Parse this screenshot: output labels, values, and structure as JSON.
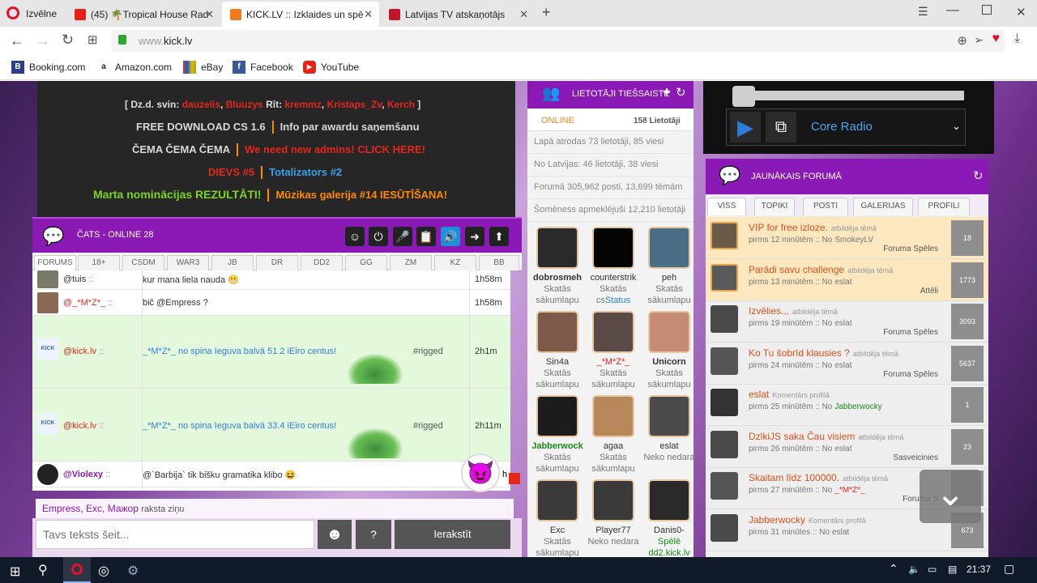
{
  "browser": {
    "menu_label": "Izvēlne",
    "tabs": [
      {
        "label": "(45) 🌴Tropical House Rad",
        "color": "#e62117"
      },
      {
        "label": "KICK.LV :: Izklaides un spē",
        "color": "#f07b1f"
      },
      {
        "label": "Latvijas TV atskaņotājs",
        "color": "#c4162a"
      }
    ],
    "new_tab_icon": "plus-icon",
    "url_prefix": "www.",
    "url_domain": "kick.lv",
    "bookmarks": [
      {
        "label": "Booking.com",
        "icon": "booking-icon",
        "color": "#2d3e8f",
        "glyph": "B"
      },
      {
        "label": "Amazon.com",
        "icon": "amazon-icon",
        "color": "#222222",
        "glyph": "a"
      },
      {
        "label": "eBay",
        "icon": "ebay-icon",
        "color": "#0064d2",
        "glyph": "e"
      },
      {
        "label": "Facebook",
        "icon": "facebook-icon",
        "color": "#3b5998",
        "glyph": "f"
      },
      {
        "label": "YouTube",
        "icon": "youtube-icon",
        "color": "#e62117",
        "glyph": "▶"
      }
    ]
  },
  "banner": {
    "dzd_prefix": "[ Dz.d. svin:",
    "birthdays": [
      "dauzelis",
      "Bluuzys"
    ],
    "rit_prefix": "Rīt:",
    "tomorrow": [
      "kremmz",
      "Kristaps_Zv",
      "Kerch"
    ],
    "close": "]",
    "line2": [
      "FREE DOWNLOAD CS 1.6",
      "Info par awardu saņemšanu"
    ],
    "line3": [
      "ČEMA ČEMA ČEMA",
      "We need new admins! CLICK HERE!"
    ],
    "line4": [
      "DIEVS #5",
      "Totalizators #2"
    ],
    "line5": [
      "Marta nominācijas REZULTĀTI!",
      "Mūzikas galerija #14 IESŪTĪŠANA!"
    ]
  },
  "chat": {
    "title": "ČATS - ONLINE 28",
    "tabs": [
      "FORUMS",
      "18+",
      "CSDM",
      "WAR3",
      "JB",
      "DR",
      "DD2",
      "GG",
      "ZM",
      "KZ",
      "BB"
    ],
    "rows": [
      {
        "name": "@tuis",
        "suffix": "::",
        "message": "kur mana liela nauda",
        "time": "1h58m"
      },
      {
        "name": "@_*M*Z*_",
        "suffix": "::",
        "message": "bič @Empress ?",
        "time": "1h58m"
      },
      {
        "name": "@kick.lv",
        "suffix": "::",
        "message": "_*M*Z*_ no spina Ieguva balvā 51.2 iEiro centus!",
        "tag": "#rigged",
        "time": "2h1m"
      },
      {
        "name": "@kick.lv",
        "suffix": "::",
        "message": "_*M*Z*_ no spina Ieguva balvā 33.4 iEiro centus!",
        "tag": "#rigged",
        "time": "2h11m"
      },
      {
        "name": "@Violexy",
        "suffix": "::",
        "message": "@`Barbija` tik bišku gramatika klibo",
        "time": "h"
      }
    ],
    "typing_users": [
      "Empress",
      "Exc",
      "Мажор"
    ],
    "typing_suffix": "raksta ziņu",
    "input_placeholder": "Tavs teksts šeit...",
    "help_label": "?",
    "send_label": "Ierakstīt"
  },
  "online": {
    "title": "LIETOTĀJI TIEŠSAISTĒ",
    "tab_label": "ONLINE",
    "count": "158 Lietotāji",
    "stats": [
      "Lapā atrodas 73 lietotāji, 85 viesi",
      "No Latvijas: 46 lietotāji, 38 viesi",
      "Forumā 305,962 posti, 13,699 tēmām",
      "Šomēness apmeklējuši 12,210 lietotāji"
    ],
    "users": [
      {
        "name": "dobrosmeh",
        "bold": true,
        "l1": "Skatās",
        "l2": "sākumlapu",
        "color": "#2a2a2a"
      },
      {
        "name": "counterstrik",
        "bold": false,
        "l1": "Skatās",
        "l2": "cs",
        "l2b": "Status",
        "color": "#050505"
      },
      {
        "name": "peh",
        "bold": false,
        "l1": "Skatās",
        "l2": "sākumlapu",
        "color": "#4b6d86"
      },
      {
        "name": "Sin4a",
        "bold": false,
        "l1": "Skatās",
        "l2": "sākumlapu",
        "color": "#7b5a4a"
      },
      {
        "name": "_*M*Z*_",
        "bold": false,
        "red": true,
        "l1": "Skatās",
        "l2": "sākumlapu",
        "color": "#5a4a45"
      },
      {
        "name": "Unicorn",
        "bold": true,
        "l1": "Skatās",
        "l2": "sākumlapu",
        "color": "#c58b74"
      },
      {
        "name": "Jabberwock",
        "bold": true,
        "green": true,
        "l1": "Skatās",
        "l2": "sākumlapu",
        "color": "#1c1c1c"
      },
      {
        "name": "agaa",
        "bold": false,
        "l1": "Skatās",
        "l2": "sākumlapu",
        "color": "#b8885a"
      },
      {
        "name": "eslat",
        "bold": false,
        "l1": "Neko nedara",
        "l2": "",
        "color": "#4a4a4a"
      },
      {
        "name": "Exc",
        "bold": false,
        "l1": "Skatās",
        "l2": "sākumlapu",
        "color": "#3a3a3a"
      },
      {
        "name": "Player77",
        "bold": false,
        "l1": "Neko nedara",
        "l2": "",
        "color": "#3a3a3a"
      },
      {
        "name": "Danis0-",
        "bold": false,
        "l1": "Spēlē",
        "l2": "dd2.kick.lv",
        "green2": true,
        "color": "#2a2a2a"
      }
    ]
  },
  "radio": {
    "station": "Core Radio",
    "progress": 0.0
  },
  "forum": {
    "title": "JAUNĀKAIS FORUMĀ",
    "tabs": [
      "VISS",
      "TOPIKI",
      "POSTI",
      "GALERIJAS",
      "PROFILI"
    ],
    "items": [
      {
        "title": "VIP for free izloze.",
        "action": "atbildēja tēmā",
        "when": "pirms 12 minūtēm :: No",
        "who": "SmokeyLV",
        "cat": "Foruma Spēles",
        "count": "18",
        "hl": true,
        "who_red": false
      },
      {
        "title": "Parādi savu challenge",
        "action": "atbildēja tēmā",
        "when": "pirms 13 minūtēm :: No",
        "who": "eslat",
        "cat": "Attēli",
        "count": "1773",
        "hl": true,
        "who_red": false
      },
      {
        "title": "Izvēlies...",
        "action": "atbildēja tēmā",
        "when": "pirms 19 minūtēm :: No",
        "who": "eslat",
        "cat": "Foruma Spēles",
        "count": "3093",
        "hl": false,
        "who_red": false
      },
      {
        "title": "Ko Tu šobrīd klausies ?",
        "action": "atbildēja tēmā",
        "when": "pirms 24 minūtēm :: No",
        "who": "eslat",
        "cat": "Foruma Spēles",
        "count": "5637",
        "hl": false,
        "who_red": false
      },
      {
        "title": "eslat",
        "action": "Komentārs profilā",
        "when": "pirms 25 minūtēm :: No",
        "who": "Jabberwocky",
        "cat": "",
        "count": "1",
        "hl": false,
        "who_red": false
      },
      {
        "title": "DzlkiJS saka Čau visiem",
        "action": "atbildēja tēmā",
        "when": "pirms 26 minūtēm :: No",
        "who": "eslat",
        "cat": "Sasveicinies",
        "count": "23",
        "hl": false,
        "who_red": false
      },
      {
        "title": "Skaitam līdz 100000.",
        "action": "atbildēja tēmā",
        "when": "pirms 27 minūtēm :: No",
        "who": "_*M*Z*_",
        "cat": "Foruma S",
        "count": "",
        "hl": false,
        "who_red": true
      },
      {
        "title": "Jabberwocky",
        "action": "Komentārs profilā",
        "when": "pirms 31 minūtes :: No",
        "who": "eslat",
        "cat": "",
        "count": "673",
        "hl": false,
        "who_red": false
      }
    ]
  },
  "taskbar": {
    "time": "21:37"
  }
}
